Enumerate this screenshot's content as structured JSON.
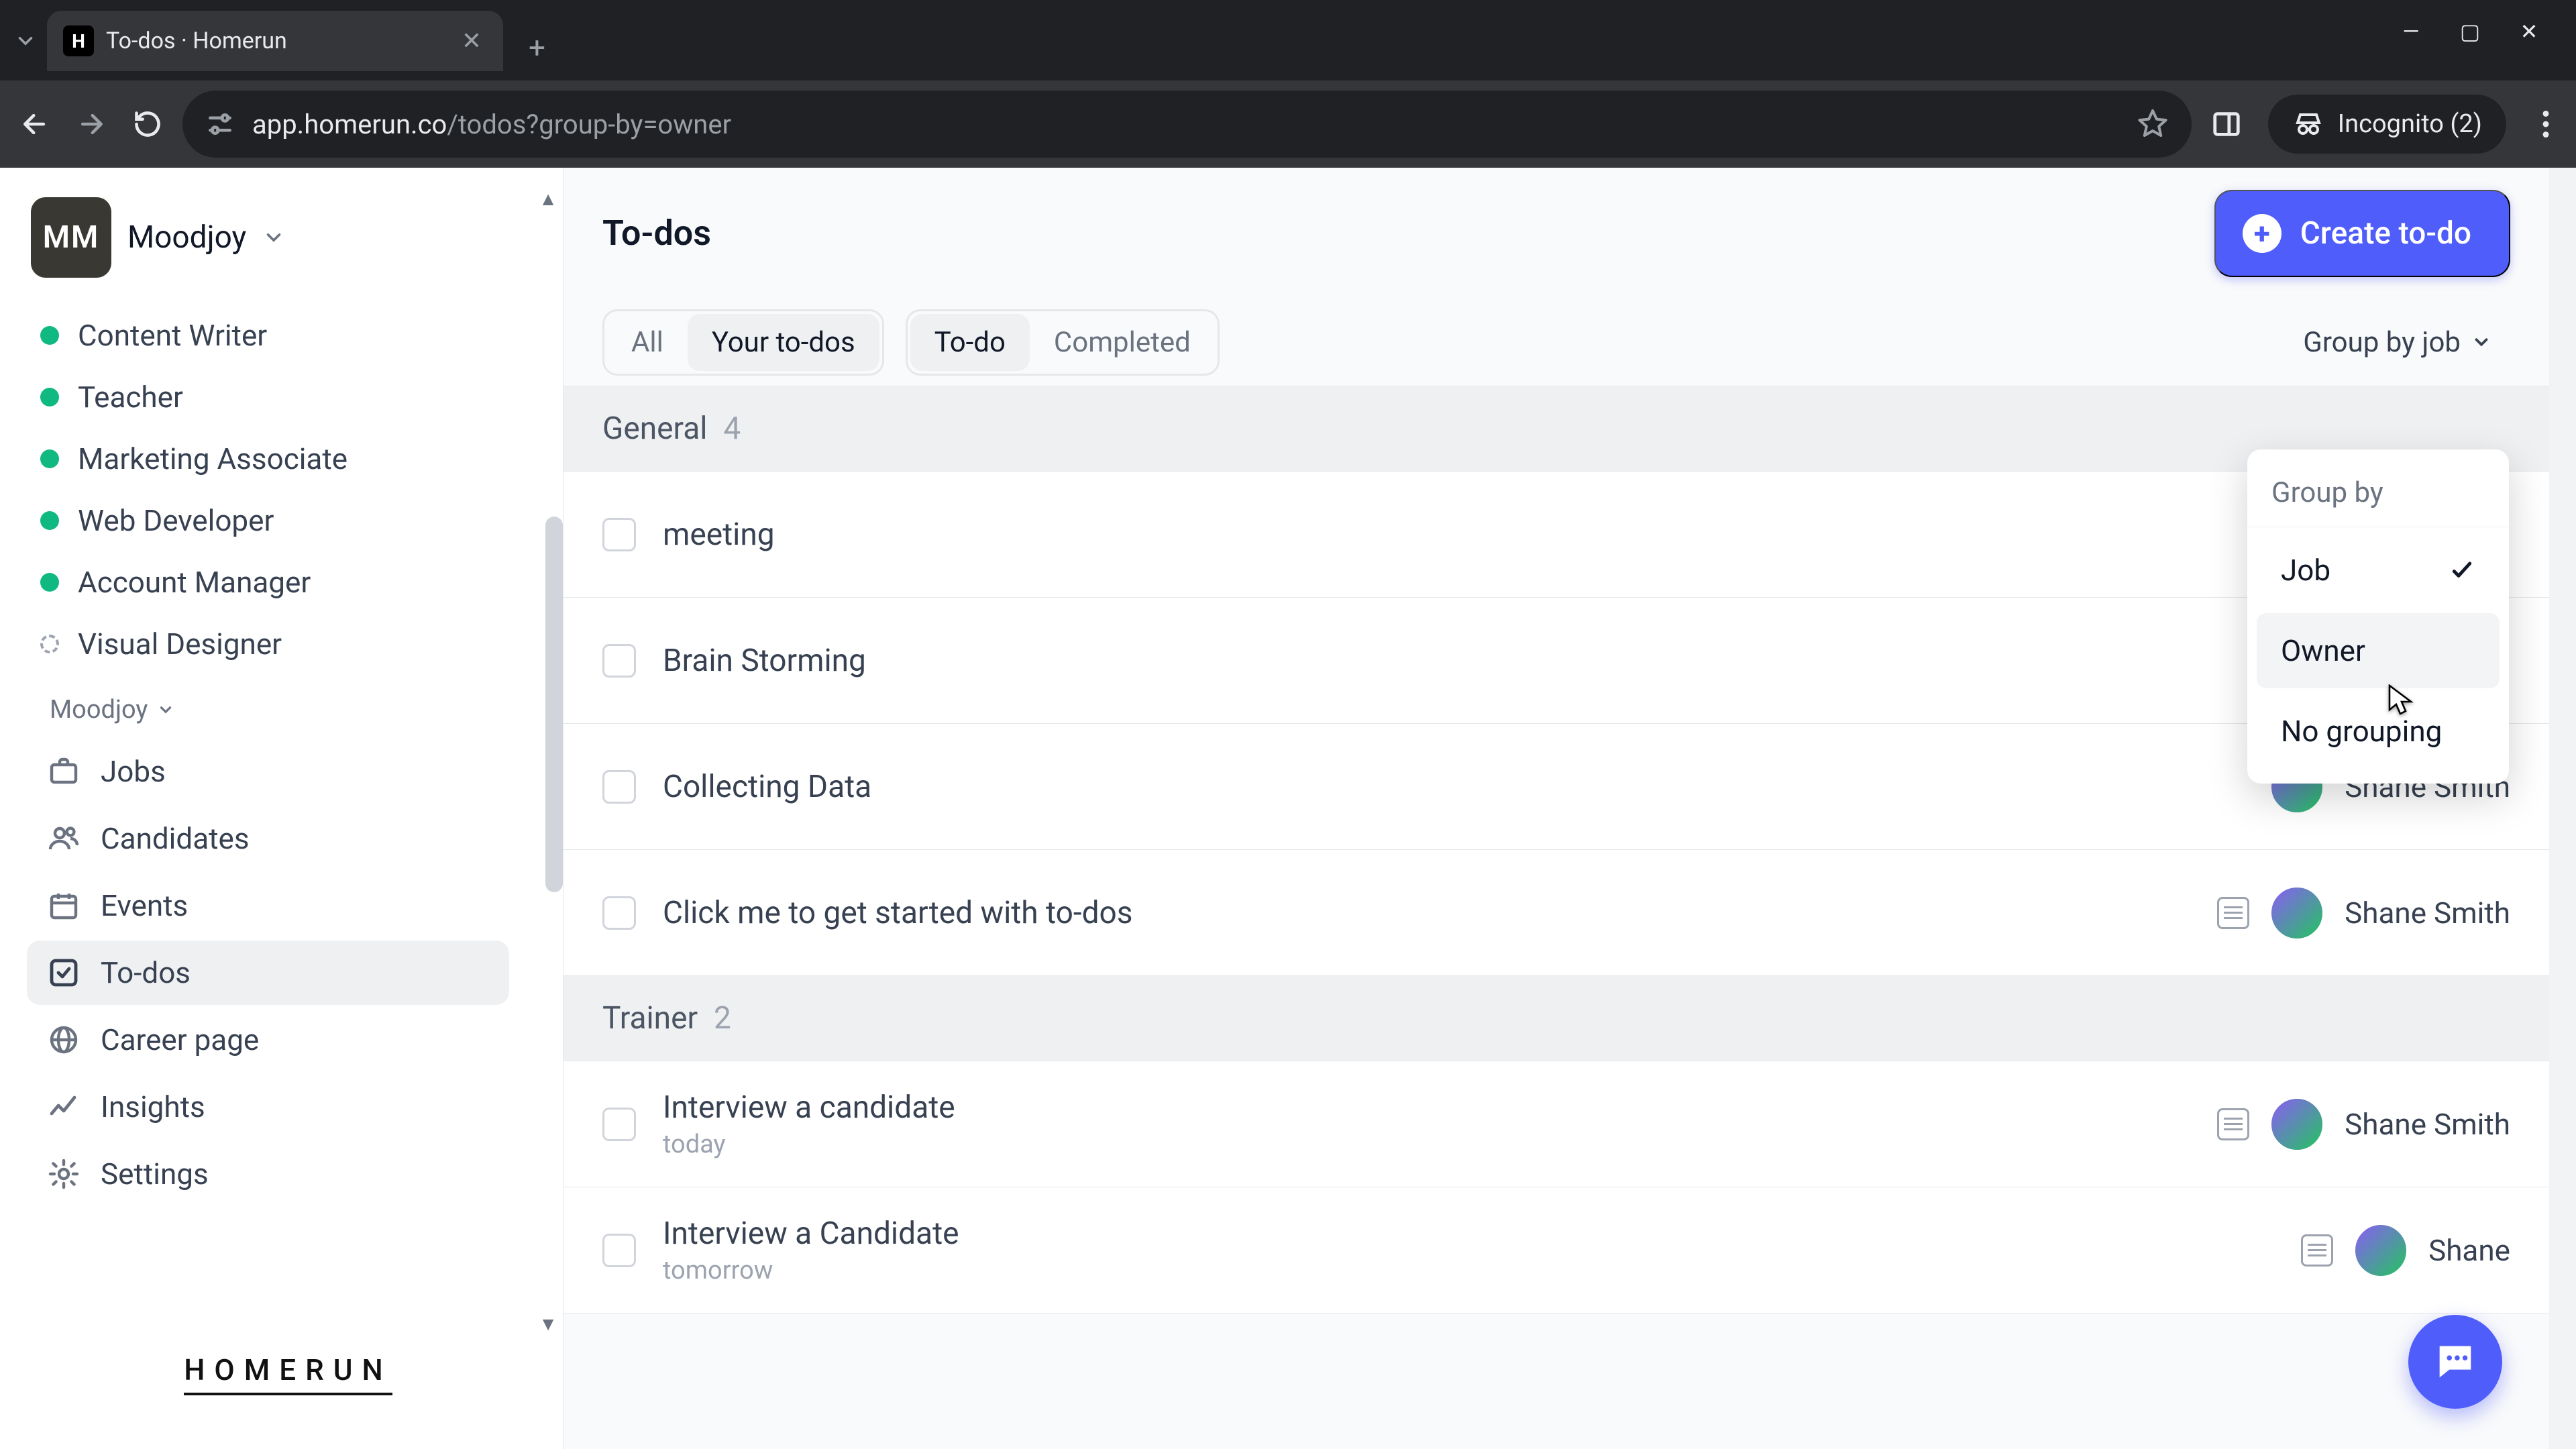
{
  "browser": {
    "tab_title": "To-dos · Homerun",
    "tab_favicon": "H",
    "url_host": "app.homerun.co",
    "url_path": "/todos?group-by=owner",
    "incognito_label": "Incognito (2)"
  },
  "sidebar": {
    "workspace_initials": "MM",
    "workspace_name": "Moodjoy",
    "jobs": [
      {
        "label": "Content Writer",
        "status": "active"
      },
      {
        "label": "Teacher",
        "status": "active"
      },
      {
        "label": "Marketing Associate",
        "status": "active"
      },
      {
        "label": "Web Developer",
        "status": "active"
      },
      {
        "label": "Account Manager",
        "status": "active"
      },
      {
        "label": "Visual Designer",
        "status": "draft"
      }
    ],
    "mini_workspace": "Moodjoy",
    "nav": {
      "jobs": "Jobs",
      "candidates": "Candidates",
      "events": "Events",
      "todos": "To-dos",
      "career": "Career page",
      "insights": "Insights",
      "settings": "Settings"
    },
    "logo": "HOMERUN"
  },
  "header": {
    "title": "To-dos",
    "create_label": "Create to-do"
  },
  "filters": {
    "all": "All",
    "yours": "Your to-dos",
    "todo": "To-do",
    "completed": "Completed",
    "group_by_label": "Group by job"
  },
  "dropdown": {
    "title": "Group by",
    "job": "Job",
    "owner": "Owner",
    "none": "No grouping"
  },
  "groups": [
    {
      "name": "General",
      "count": "4",
      "items": [
        {
          "title": "meeting"
        },
        {
          "title": "Brain Storming"
        },
        {
          "title": "Collecting Data",
          "assignee": "Shane Smith"
        },
        {
          "title": "Click me to get started with to-dos",
          "assignee": "Shane Smith",
          "has_note": true
        }
      ]
    },
    {
      "name": "Trainer",
      "count": "2",
      "items": [
        {
          "title": "Interview a candidate",
          "sub": "today",
          "assignee": "Shane Smith",
          "has_note": true
        },
        {
          "title": "Interview a Candidate",
          "sub": "tomorrow",
          "assignee": "Shane",
          "has_note": true
        }
      ]
    }
  ]
}
